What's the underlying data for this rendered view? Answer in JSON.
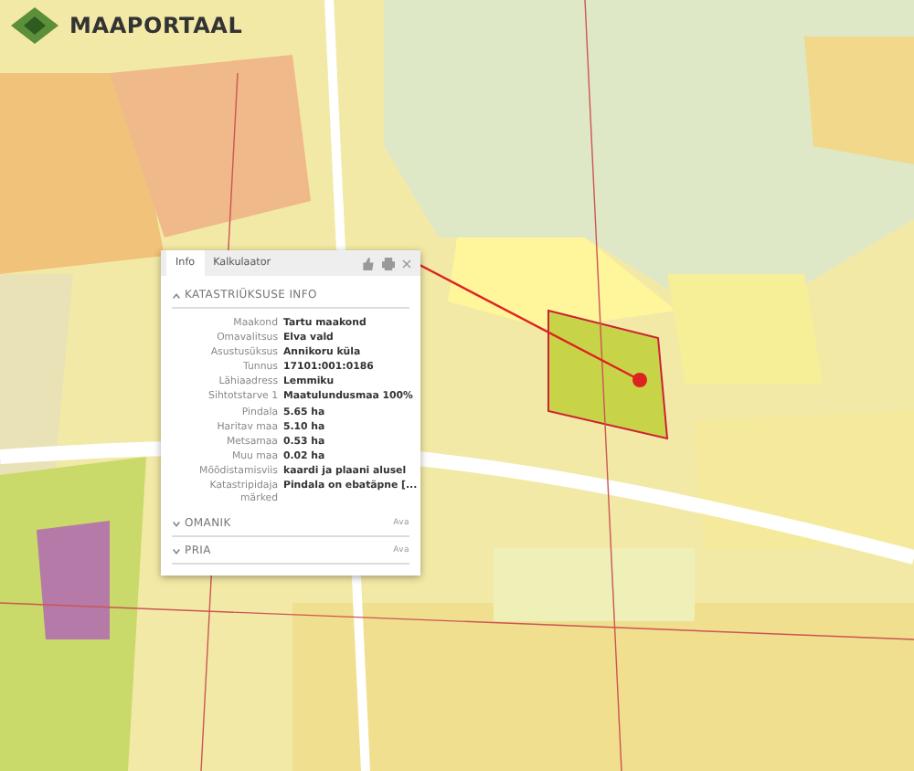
{
  "logo": {
    "text": "MAAPORTAAL"
  },
  "popup": {
    "tabs": [
      {
        "label": "Info",
        "selected": true
      },
      {
        "label": "Kalkulaator",
        "selected": false
      }
    ],
    "section": {
      "title": "KATASTRIÜKSUSE INFO",
      "expanded": true,
      "rows": [
        {
          "label": "Maakond",
          "value": "Tartu maakond"
        },
        {
          "label": "Omavalitsus",
          "value": "Elva vald"
        },
        {
          "label": "Asustusüksus",
          "value": "Annikoru küla"
        },
        {
          "label": "Tunnus",
          "value": "17101:001:0186"
        },
        {
          "label": "Lähiaadress",
          "value": "Lemmiku"
        },
        {
          "label": "Sihtotstarve 1",
          "value": "Maatulundusmaa 100%"
        },
        {
          "label": "Pindala",
          "value": "5.65 ha"
        },
        {
          "label": "Haritav maa",
          "value": "5.10 ha"
        },
        {
          "label": "Metsamaa",
          "value": "0.53 ha"
        },
        {
          "label": "Muu maa",
          "value": "0.02 ha"
        },
        {
          "label": "Mõõdistamisviis",
          "value": "kaardi ja plaani alusel"
        },
        {
          "label": "Katastripidaja märked",
          "value": "Pindala on ebatäpne [..."
        }
      ]
    },
    "collapsed": [
      {
        "title": "OMANIK",
        "expanded": false,
        "action": "Ava"
      },
      {
        "title": "PRIA",
        "expanded": false,
        "action": "Ava"
      }
    ]
  }
}
